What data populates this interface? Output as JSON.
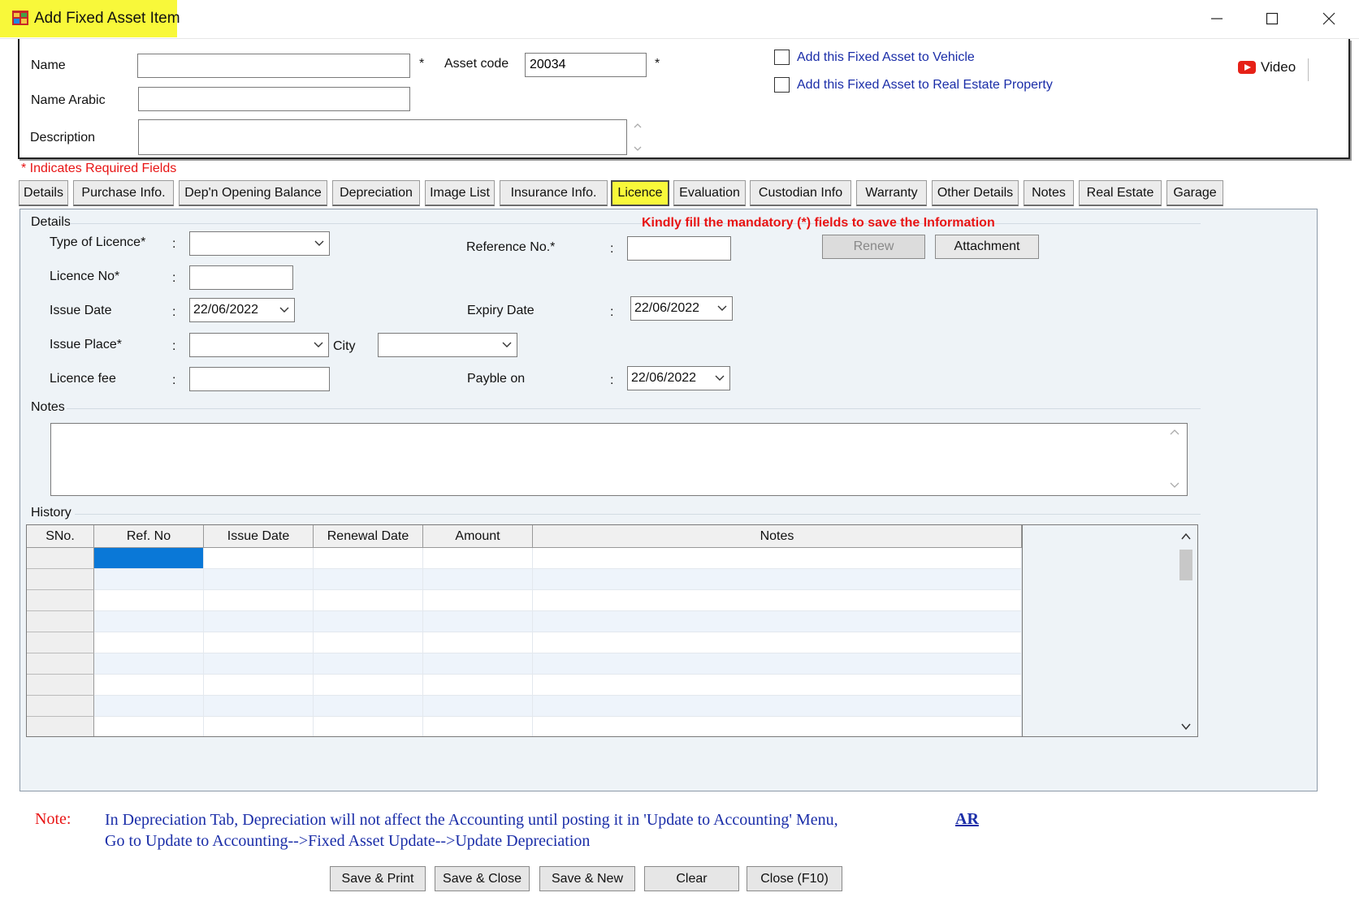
{
  "window": {
    "title": "Add Fixed Asset Item",
    "highlight_color": "#f8f83a"
  },
  "header": {
    "name_label": "Name",
    "name_value": "",
    "name_arabic_label": "Name Arabic",
    "name_arabic_value": "",
    "description_label": "Description",
    "description_value": "",
    "asset_code_label": "Asset code",
    "asset_code_value": "20034",
    "required_star": "*",
    "vehicle_checkbox_label": "Add this Fixed Asset to Vehicle",
    "vehicle_checked": false,
    "real_estate_checkbox_label": "Add this Fixed Asset to Real Estate Property",
    "real_estate_checked": false,
    "video_label": "Video",
    "required_note": "* Indicates Required Fields"
  },
  "tabs": [
    {
      "label": "Details",
      "active": false
    },
    {
      "label": "Purchase Info.",
      "active": false
    },
    {
      "label": "Dep'n Opening Balance",
      "active": false
    },
    {
      "label": "Depreciation",
      "active": false
    },
    {
      "label": "Image List",
      "active": false
    },
    {
      "label": "Insurance Info.",
      "active": false
    },
    {
      "label": "Licence",
      "active": true
    },
    {
      "label": "Evaluation",
      "active": false
    },
    {
      "label": "Custodian Info",
      "active": false
    },
    {
      "label": "Warranty",
      "active": false
    },
    {
      "label": "Other Details",
      "active": false
    },
    {
      "label": "Notes",
      "active": false
    },
    {
      "label": "Real Estate",
      "active": false
    },
    {
      "label": "Garage",
      "active": false
    }
  ],
  "licence": {
    "details_group": "Details",
    "mandatory_message": "Kindly fill the mandatory (*) fields to save the Information",
    "colon": ":",
    "type_of_licence_label": "Type of Licence*",
    "type_of_licence_value": "",
    "licence_no_label": "Licence No*",
    "licence_no_value": "",
    "issue_date_label": "Issue Date",
    "issue_date_value": "22/06/2022",
    "issue_place_label": "Issue Place*",
    "issue_place_value": "",
    "city_label": "City",
    "city_value": "",
    "licence_fee_label": "Licence fee",
    "licence_fee_value": "",
    "reference_no_label": "Reference No.*",
    "reference_no_value": "",
    "expiry_date_label": "Expiry Date",
    "expiry_date_value": "22/06/2022",
    "payble_on_label": "Payble on",
    "payble_on_value": "22/06/2022",
    "renew_button": "Renew",
    "attachment_button": "Attachment",
    "notes_group": "Notes",
    "notes_value": "",
    "history_group": "History"
  },
  "history": {
    "columns": [
      "SNo.",
      "Ref. No",
      "Issue Date",
      "Renewal Date",
      "Amount",
      "Notes"
    ],
    "rows": []
  },
  "footer": {
    "note_label": "Note:",
    "note_line1": "In Depreciation Tab, Depreciation will not affect the Accounting until posting it in 'Update to Accounting' Menu,",
    "note_line2": "Go to Update to Accounting-->Fixed Asset Update-->Update Depreciation",
    "ar_link": "AR",
    "buttons": [
      "Save & Print",
      "Save & Close",
      "Save & New",
      "Clear",
      "Close (F10)"
    ]
  }
}
